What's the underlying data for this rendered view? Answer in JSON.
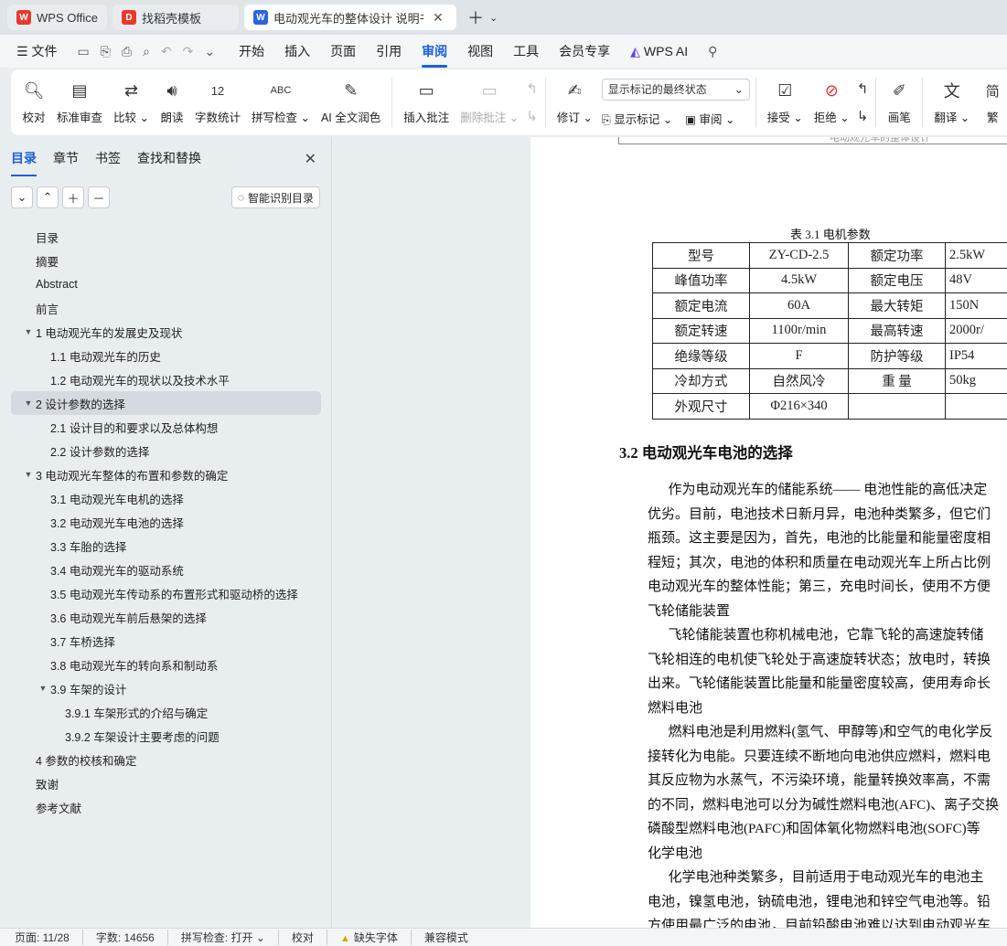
{
  "tabs": [
    {
      "label": "WPS Office",
      "logo": "W",
      "color": "#e8392f"
    },
    {
      "label": "找稻壳模板",
      "logo": "D",
      "color": "#e8392f"
    },
    {
      "label": "电动观光车的整体设计 说明书",
      "logo": "W",
      "color": "#2a64e0"
    }
  ],
  "menu": {
    "file": "文件",
    "items": [
      "开始",
      "插入",
      "页面",
      "引用",
      "审阅",
      "视图",
      "工具",
      "会员专享"
    ],
    "active": "审阅",
    "ai": "WPS AI"
  },
  "ribbon": {
    "proofread": "校对",
    "standard_review": "标准审查",
    "compare": "比较",
    "read_aloud": "朗读",
    "word_count": "字数统计",
    "spell_check": "拼写检查",
    "ai_polish": "AI 全文润色",
    "insert_comment": "插入批注",
    "delete_comment": "删除批注",
    "revise": "修订",
    "show_markup_select": "显示标记的最终状态",
    "show_markup": "显示标记",
    "review": "审阅",
    "accept": "接受",
    "reject": "拒绝",
    "pen": "画笔",
    "translate": "翻译",
    "simplify": "简"
  },
  "nav": {
    "tabs": [
      "目录",
      "章节",
      "书签",
      "查找和替换"
    ],
    "smart_toc": "智能识别目录",
    "toc": [
      {
        "label": "目录",
        "level": 1,
        "caret": false
      },
      {
        "label": "摘要",
        "level": 1,
        "caret": false
      },
      {
        "label": "Abstract",
        "level": 1,
        "caret": false
      },
      {
        "label": "前言",
        "level": 1,
        "caret": false
      },
      {
        "label": "1  电动观光车的发展史及现状",
        "level": 1,
        "caret": true
      },
      {
        "label": "1.1 电动观光车的历史",
        "level": 2,
        "caret": false
      },
      {
        "label": "1.2  电动观光车的现状以及技术水平",
        "level": 2,
        "caret": false
      },
      {
        "label": "2 设计参数的选择",
        "level": 1,
        "caret": true,
        "selected": true
      },
      {
        "label": "2.1    设计目的和要求以及总体构想",
        "level": 2,
        "caret": false
      },
      {
        "label": "2.2 设计参数的选择",
        "level": 2,
        "caret": false
      },
      {
        "label": "3  电动观光车整体的布置和参数的确定",
        "level": 1,
        "caret": true
      },
      {
        "label": "3.1 电动观光车电机的选择",
        "level": 2,
        "caret": false
      },
      {
        "label": "3.2 电动观光车电池的选择",
        "level": 2,
        "caret": false
      },
      {
        "label": "3.3  车胎的选择",
        "level": 2,
        "caret": false
      },
      {
        "label": "3.4 电动观光车的驱动系统",
        "level": 2,
        "caret": false
      },
      {
        "label": "3.5  电动观光车传动系的布置形式和驱动桥的选择",
        "level": 2,
        "caret": false
      },
      {
        "label": "3.6  电动观光车前后悬架的选择",
        "level": 2,
        "caret": false
      },
      {
        "label": "3.7  车桥选择",
        "level": 2,
        "caret": false
      },
      {
        "label": "3.8  电动观光车的转向系和制动系",
        "level": 2,
        "caret": false
      },
      {
        "label": "3.9 车架的设计",
        "level": 2,
        "caret": true
      },
      {
        "label": "3.9.1 车架形式的介绍与确定",
        "level": 3,
        "caret": false
      },
      {
        "label": "3.9.2 车架设计主要考虑的问题",
        "level": 3,
        "caret": false
      },
      {
        "label": "4  参数的校核和确定",
        "level": 1,
        "caret": false
      },
      {
        "label": "致谢",
        "level": 1,
        "caret": false
      },
      {
        "label": "参考文献",
        "level": 1,
        "caret": false
      }
    ]
  },
  "doc": {
    "header_text": "电动观光车的整体设计",
    "table_caption": "表 3.1  电机参数",
    "table": [
      [
        "型号",
        "ZY-CD-2.5",
        "额定功率",
        "2.5kW"
      ],
      [
        "峰值功率",
        "4.5kW",
        "额定电压",
        "48V"
      ],
      [
        "额定电流",
        "60A",
        "最大转矩",
        "150N"
      ],
      [
        "额定转速",
        "1100r/min",
        "最高转速",
        "2000r/"
      ],
      [
        "绝缘等级",
        "F",
        "防护等级",
        "IP54"
      ],
      [
        "冷却方式",
        "自然风冷",
        "重  量",
        "50kg"
      ],
      [
        "外观尺寸",
        "Φ216×340",
        "",
        ""
      ]
    ],
    "heading": "3.2 电动观光车电池的选择",
    "lines": [
      "      作为电动观光车的储能系统—— 电池性能的高低决定",
      "优劣。目前，电池技术日新月异，电池种类繁多，但它们",
      "瓶颈。这主要是因为，首先，电池的比能量和能量密度相",
      "程短；其次，电池的体积和质量在电动观光车上所占比例",
      "电动观光车的整体性能；第三，充电时间长，使用不方便",
      "飞轮储能装置",
      "      飞轮储能装置也称机械电池，它靠飞轮的高速旋转储",
      "飞轮相连的电机使飞轮处于高速旋转状态；放电时，转换",
      "出来。飞轮储能装置比能量和能量密度较高，使用寿命长",
      "燃料电池",
      "      燃料电池是利用燃料(氢气、甲醇等)和空气的电化学反",
      "接转化为电能。只要连续不断地向电池供应燃料，燃料电",
      "其反应物为水蒸气，不污染环境，能量转换效率高，不需",
      "的不同，燃料电池可以分为碱性燃料电池(AFC)、离子交换",
      "磷酸型燃料电池(PAFC)和固体氧化物燃料电池(SOFC)等",
      "化学电池",
      "      化学电池种类繁多，目前适用于电动观光车的电池主",
      "电池，镍氢电池，钠硫电池，锂电池和锌空气电池等。铅",
      "方使用最广泛的电池，目前铅酸电池难以达到电动观光车"
    ]
  },
  "status": {
    "page": "页面: 11/28",
    "words": "字数: 14656",
    "spell": "拼写检查: 打开",
    "proof": "校对",
    "missing_font": "缺失字体",
    "compat": "兼容模式"
  },
  "colors": {
    "accent": "#1a5fd8",
    "wps_red": "#e8392f",
    "ai_purple": "#6a3cf0"
  }
}
